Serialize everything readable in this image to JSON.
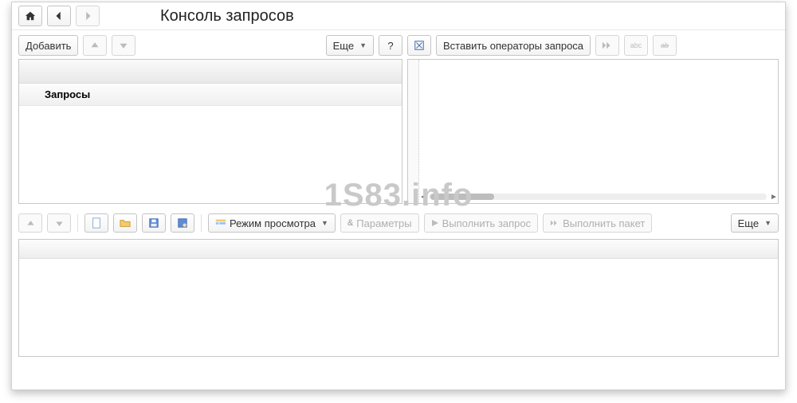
{
  "window": {
    "title": "Консоль запросов"
  },
  "left_toolbar": {
    "add_label": "Добавить",
    "more_label": "Еще",
    "help_label": "?"
  },
  "right_toolbar": {
    "insert_ops_label": "Вставить операторы запроса"
  },
  "left_pane": {
    "tree_root_label": "Запросы"
  },
  "bottom_toolbar": {
    "view_mode_label": "Режим просмотра",
    "params_label": "Параметры",
    "run_query_label": "Выполнить запрос",
    "run_packet_label": "Выполнить пакет",
    "more_label": "Еще"
  },
  "watermark": "1S83.info"
}
